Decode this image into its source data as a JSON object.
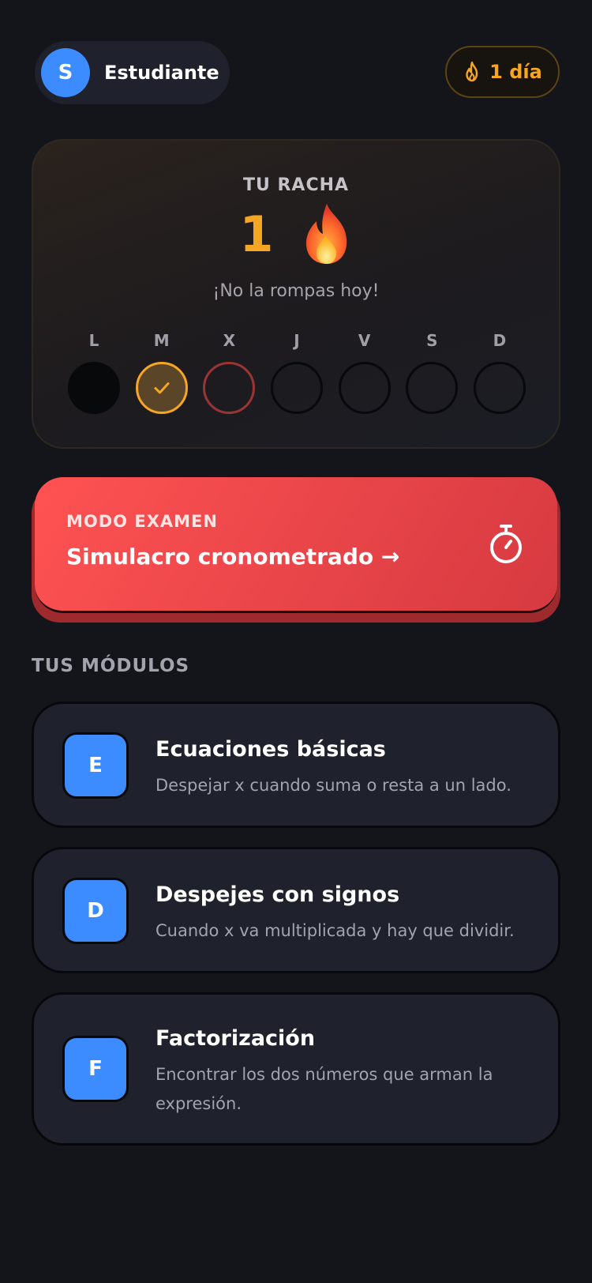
{
  "header": {
    "avatar_initial": "S",
    "user_name": "Estudiante",
    "streak_badge": "1 día",
    "flame_icon": "flame-outline-icon"
  },
  "streak": {
    "label": "TU RACHA",
    "count": "1",
    "flame_icon": "flame-emoji-icon",
    "subtitle": "¡No la rompas hoy!",
    "days": [
      {
        "letter": "L",
        "state": "filled"
      },
      {
        "letter": "M",
        "state": "done"
      },
      {
        "letter": "X",
        "state": "today"
      },
      {
        "letter": "J",
        "state": "empty"
      },
      {
        "letter": "V",
        "state": "empty"
      },
      {
        "letter": "S",
        "state": "empty"
      },
      {
        "letter": "D",
        "state": "empty"
      }
    ]
  },
  "exam": {
    "kicker": "MODO EXAMEN",
    "title": "Simulacro cronometrado →",
    "icon": "stopwatch-icon"
  },
  "modules": {
    "label": "TUS MÓDULOS",
    "items": [
      {
        "initial": "E",
        "title": "Ecuaciones básicas",
        "desc": "Despejar x cuando suma o resta a un lado."
      },
      {
        "initial": "D",
        "title": "Despejes con signos",
        "desc": "Cuando x va multiplicada y hay que dividir."
      },
      {
        "initial": "F",
        "title": "Factorización",
        "desc": "Encontrar los dos números que arman la expresión."
      }
    ]
  },
  "colors": {
    "accent_blue": "#3d8cff",
    "streak_orange": "#f5a623",
    "exam_red": "#ff5252",
    "background": "#13151b",
    "card": "#1f222c"
  }
}
